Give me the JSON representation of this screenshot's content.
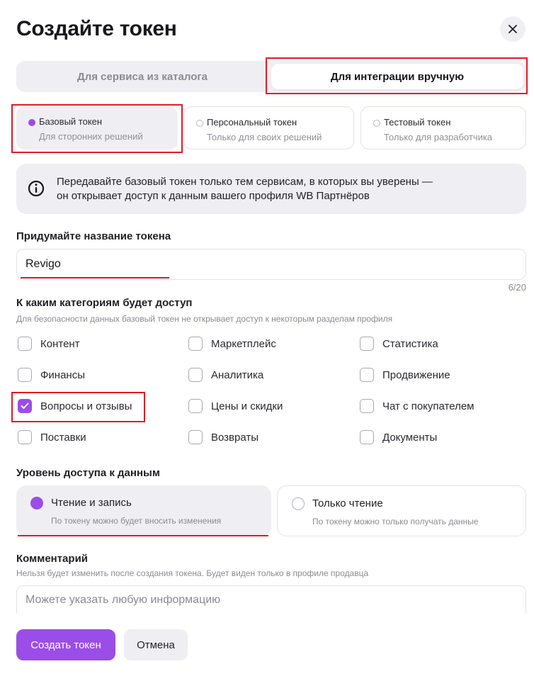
{
  "dialog": {
    "title": "Создайте токен"
  },
  "tabs": [
    {
      "label": "Для сервиса из каталога",
      "selected": false
    },
    {
      "label": "Для интеграции вручную",
      "selected": true
    }
  ],
  "token_types": [
    {
      "title": "Базовый токен",
      "subtitle": "Для сторонних решений",
      "selected": true
    },
    {
      "title": "Персональный токен",
      "subtitle": "Только для своих решений",
      "selected": false
    },
    {
      "title": "Тестовый токен",
      "subtitle": "Только для разработчика",
      "selected": false
    }
  ],
  "info_banner": {
    "line1": "Передавайте базовый токен только тем сервисам, в которых вы уверены —",
    "line2": "он открывает доступ к данным вашего профиля WB Партнёров"
  },
  "name_field": {
    "label": "Придумайте название токена",
    "value": "Revigo",
    "counter": "6/20"
  },
  "categories": {
    "label": "К каким категориям будет доступ",
    "hint": "Для безопасности данных базовый токен не открывает доступ к некоторым разделам профиля",
    "items": [
      {
        "label": "Контент",
        "checked": false
      },
      {
        "label": "Маркетплейс",
        "checked": false
      },
      {
        "label": "Статистика",
        "checked": false
      },
      {
        "label": "Финансы",
        "checked": false
      },
      {
        "label": "Аналитика",
        "checked": false
      },
      {
        "label": "Продвижение",
        "checked": false
      },
      {
        "label": "Вопросы и отзывы",
        "checked": true
      },
      {
        "label": "Цены и скидки",
        "checked": false
      },
      {
        "label": "Чат с покупателем",
        "checked": false
      },
      {
        "label": "Поставки",
        "checked": false
      },
      {
        "label": "Возвраты",
        "checked": false
      },
      {
        "label": "Документы",
        "checked": false
      }
    ]
  },
  "access_level": {
    "label": "Уровень доступа к данным",
    "options": [
      {
        "title": "Чтение и запись",
        "subtitle": "По токену можно будет вносить изменения",
        "selected": true
      },
      {
        "title": "Только чтение",
        "subtitle": "По токену можно только получать данные",
        "selected": false
      }
    ]
  },
  "comment": {
    "label": "Комментарий",
    "hint": "Нельзя будет изменить после создания токена. Будет виден только в профиле продавца",
    "placeholder": "Можете указать любую информацию"
  },
  "buttons": {
    "create": "Создать токен",
    "cancel": "Отмена"
  },
  "colors": {
    "accent": "#9b4de8",
    "highlight": "#e01b24",
    "surface": "#efeff3"
  },
  "icons": {
    "close": "close-icon",
    "info": "info-icon",
    "check": "check-icon"
  }
}
